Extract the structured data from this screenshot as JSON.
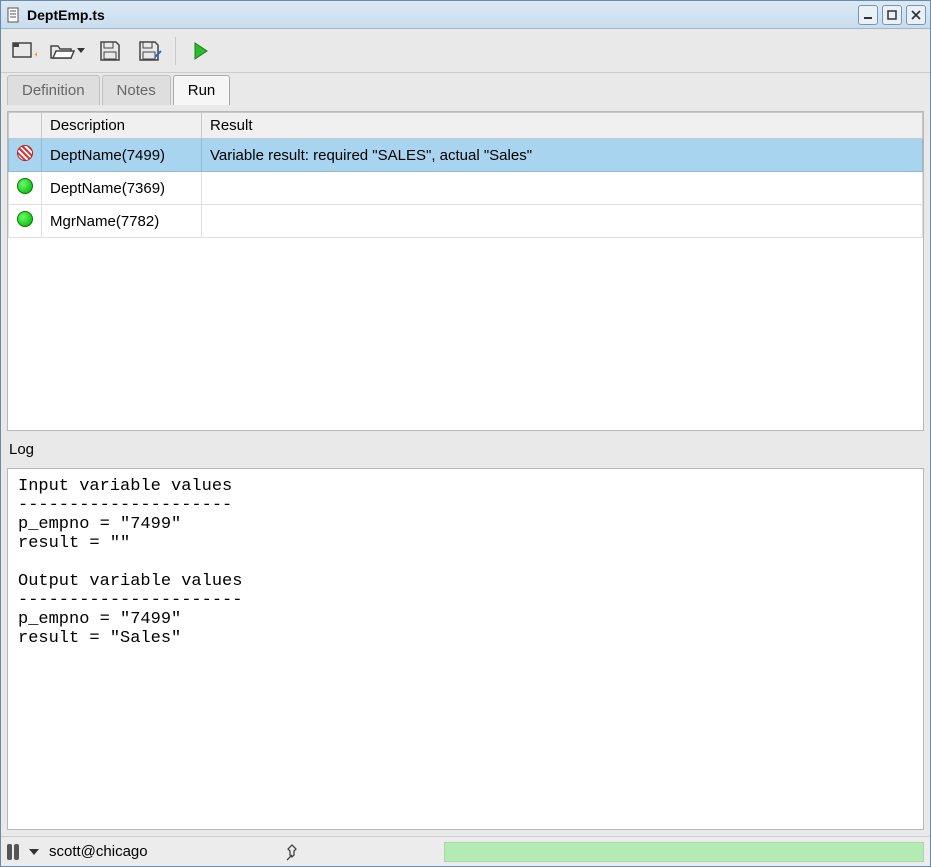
{
  "window": {
    "title": "DeptEmp.ts"
  },
  "tabs": {
    "definition": "Definition",
    "notes": "Notes",
    "run": "Run",
    "active": "run"
  },
  "grid": {
    "headers": {
      "description": "Description",
      "result": "Result"
    },
    "rows": [
      {
        "status": "fail",
        "description": "DeptName(7499)",
        "result": "Variable result: required \"SALES\", actual \"Sales\"",
        "selected": true
      },
      {
        "status": "pass",
        "description": "DeptName(7369)",
        "result": "",
        "selected": false
      },
      {
        "status": "pass",
        "description": "MgrName(7782)",
        "result": "",
        "selected": false
      }
    ]
  },
  "log": {
    "label": "Log",
    "text": "Input variable values\n---------------------\np_empno = \"7499\"\nresult = \"\"\n\nOutput variable values\n----------------------\np_empno = \"7499\"\nresult = \"Sales\""
  },
  "statusbar": {
    "connection": "scott@chicago"
  },
  "icons": {
    "file": "file-icon",
    "new": "new-tab-icon",
    "open": "folder-open-icon",
    "save": "save-icon",
    "save_edit": "save-edit-icon",
    "run": "play-icon",
    "pin": "pin-icon",
    "minimize": "minimize-icon",
    "maximize": "maximize-icon",
    "close": "close-icon"
  }
}
